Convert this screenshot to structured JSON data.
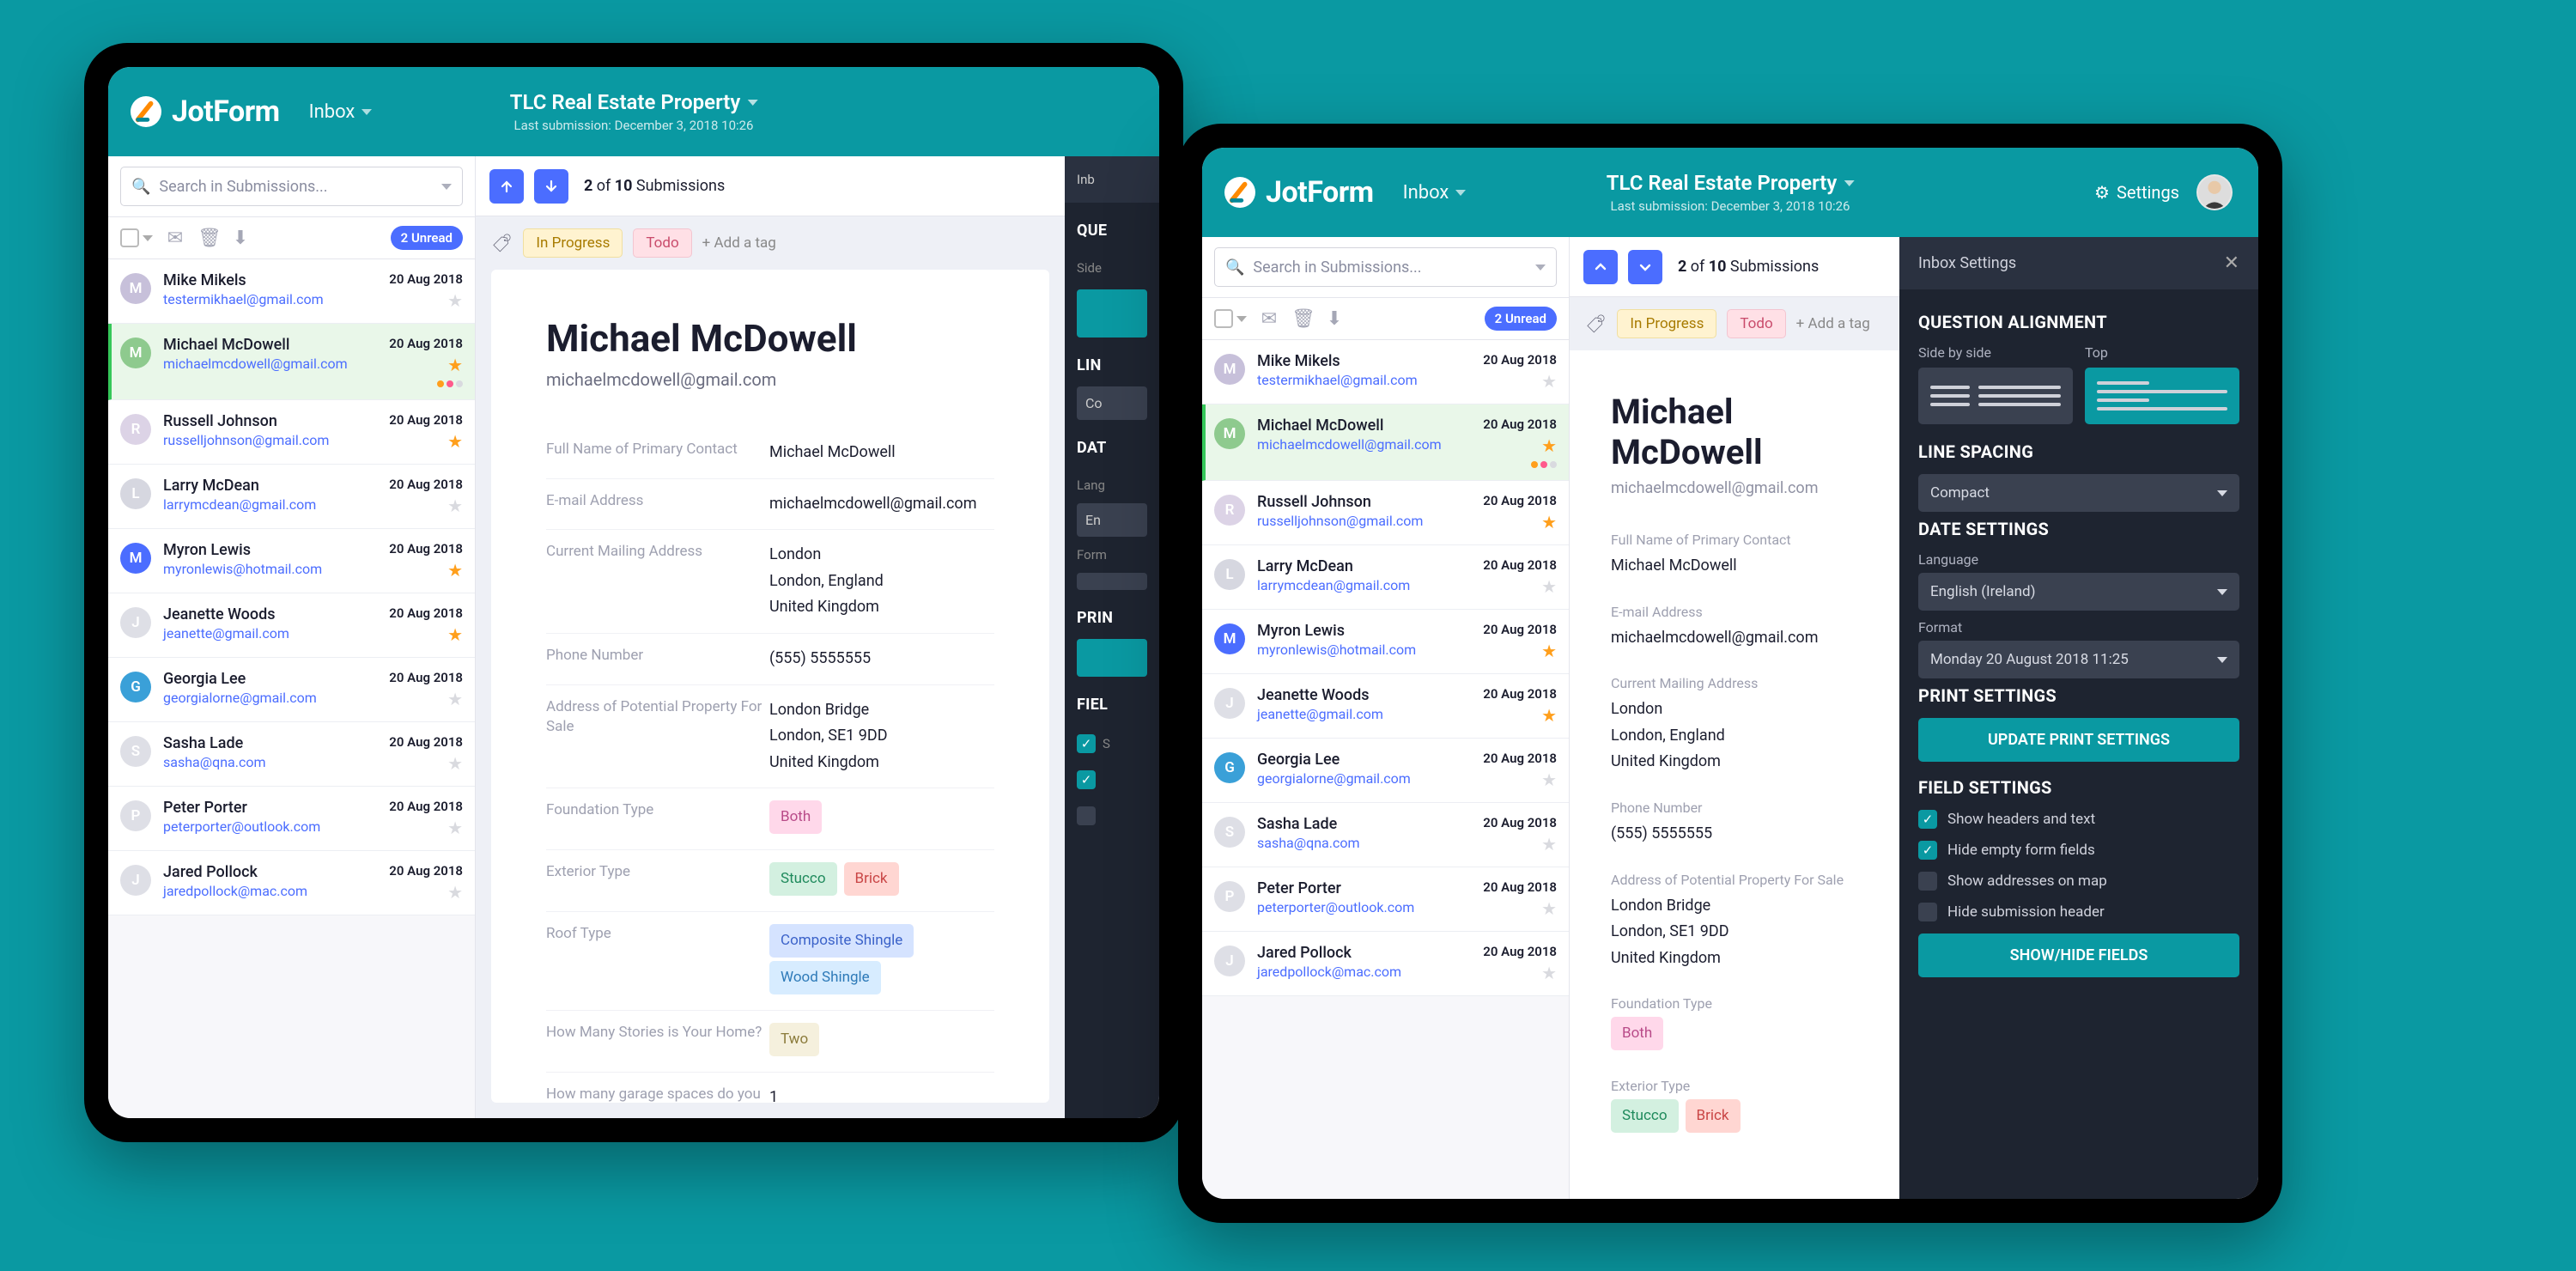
{
  "brand": "JotForm",
  "header": {
    "inbox_label": "Inbox",
    "form_title": "TLC Real Estate Property",
    "subtitle": "Last submission: December 3, 2018 10:26",
    "settings_label": "Settings"
  },
  "search": {
    "placeholder": "Search in Submissions..."
  },
  "nav": {
    "count_current": "2",
    "count_total": "10",
    "count_word": "Submissions"
  },
  "toolbar": {
    "unread_badge": "2 Unread"
  },
  "tags": {
    "in_progress": "In Progress",
    "todo": "Todo",
    "add": "+ Add a tag"
  },
  "submissions": [
    {
      "initial": "M",
      "color": "#c7c0da",
      "name": "Mike Mikels",
      "email": "testermikhael@gmail.com",
      "date": "20 Aug 2018",
      "star": false
    },
    {
      "initial": "M",
      "color": "#8eca8e",
      "name": "Michael McDowell",
      "email": "michaelmcdowell@gmail.com",
      "date": "20 Aug 2018",
      "star": true,
      "active": true,
      "dots": true
    },
    {
      "initial": "R",
      "color": "#dcd3e6",
      "name": "Russell Johnson",
      "email": "russelljohnson@gmail.com",
      "date": "20 Aug 2018",
      "star": true
    },
    {
      "initial": "L",
      "color": "#d6d7e0",
      "name": "Larry McDean",
      "email": "larrymcdean@gmail.com",
      "date": "20 Aug 2018",
      "star": false
    },
    {
      "initial": "M",
      "color": "#4b6dff",
      "name": "Myron Lewis",
      "email": "myronlewis@hotmail.com",
      "date": "20 Aug 2018",
      "star": true
    },
    {
      "initial": "J",
      "color": "#dedfe6",
      "name": "Jeanette Woods",
      "email": "jeanette@gmail.com",
      "date": "20 Aug 2018",
      "star": true
    },
    {
      "initial": "G",
      "color": "#3aa0d8",
      "name": "Georgia Lee",
      "email": "georgialorne@gmail.com",
      "date": "20 Aug 2018",
      "star": false
    },
    {
      "initial": "S",
      "color": "#dedfe6",
      "name": "Sasha Lade",
      "email": "sasha@qna.com",
      "date": "20 Aug 2018",
      "star": false
    },
    {
      "initial": "P",
      "color": "#dedfe6",
      "name": "Peter Porter",
      "email": "peterporter@outlook.com",
      "date": "20 Aug 2018",
      "star": false
    },
    {
      "initial": "J",
      "color": "#dedfe6",
      "name": "Jared Pollock",
      "email": "jaredpollock@mac.com",
      "date": "20 Aug 2018",
      "star": false
    }
  ],
  "detail": {
    "name": "Michael McDowell",
    "email": "michaelmcdowell@gmail.com",
    "fields": [
      {
        "label": "Full Name of Primary Contact",
        "value": "Michael McDowell"
      },
      {
        "label": "E-mail Address",
        "value": "michaelmcdowell@gmail.com"
      },
      {
        "label": "Current Mailing Address",
        "value": "London\nLondon, England\nUnited Kingdom"
      },
      {
        "label": "Phone Number",
        "value": "(555) 5555555"
      },
      {
        "label": "Address of Potential Property For Sale",
        "value": "London Bridge\nLondon, SE1 9DD\nUnited Kingdom"
      },
      {
        "label": "Foundation Type",
        "chips": [
          {
            "t": "Both",
            "c": "pink"
          }
        ]
      },
      {
        "label": "Exterior Type",
        "chips": [
          {
            "t": "Stucco",
            "c": "green"
          },
          {
            "t": "Brick",
            "c": "red"
          }
        ]
      },
      {
        "label": "Roof Type",
        "chips": [
          {
            "t": "Composite Shingle",
            "c": "blue"
          },
          {
            "t": "Wood Shingle",
            "c": "lightblue"
          }
        ]
      },
      {
        "label": "How Many Stories is Your Home?",
        "chips": [
          {
            "t": "Two",
            "c": "cream"
          }
        ]
      },
      {
        "label": "How many garage spaces do you have?",
        "value": "1"
      }
    ]
  },
  "settings": {
    "panel_title": "Inbox Settings",
    "question_alignment": "QUESTION ALIGNMENT",
    "side_by_side": "Side by side",
    "top": "Top",
    "line_spacing": "LINE SPACING",
    "compact": "Compact",
    "date_settings": "DATE SETTINGS",
    "language_label": "Language",
    "language_value": "English (Ireland)",
    "format_label": "Format",
    "format_value": "Monday 20 August 2018 11:25",
    "print_settings": "PRINT SETTINGS",
    "update_print": "UPDATE PRINT SETTINGS",
    "field_settings": "FIELD SETTINGS",
    "show_headers": "Show headers and text",
    "hide_empty": "Hide empty form fields",
    "show_map": "Show addresses on map",
    "hide_header": "Hide submission header",
    "show_hide_fields": "SHOW/HIDE FIELDS"
  },
  "sliver": {
    "inb": "Inb",
    "que": "QUE",
    "side": "Side",
    "lin": "LIN",
    "co": "Co",
    "dat": "DAT",
    "lang": "Lang",
    "en": "En",
    "form": "Form",
    "prin": "PRIN",
    "fiel": "FIEL",
    "s": "S"
  }
}
